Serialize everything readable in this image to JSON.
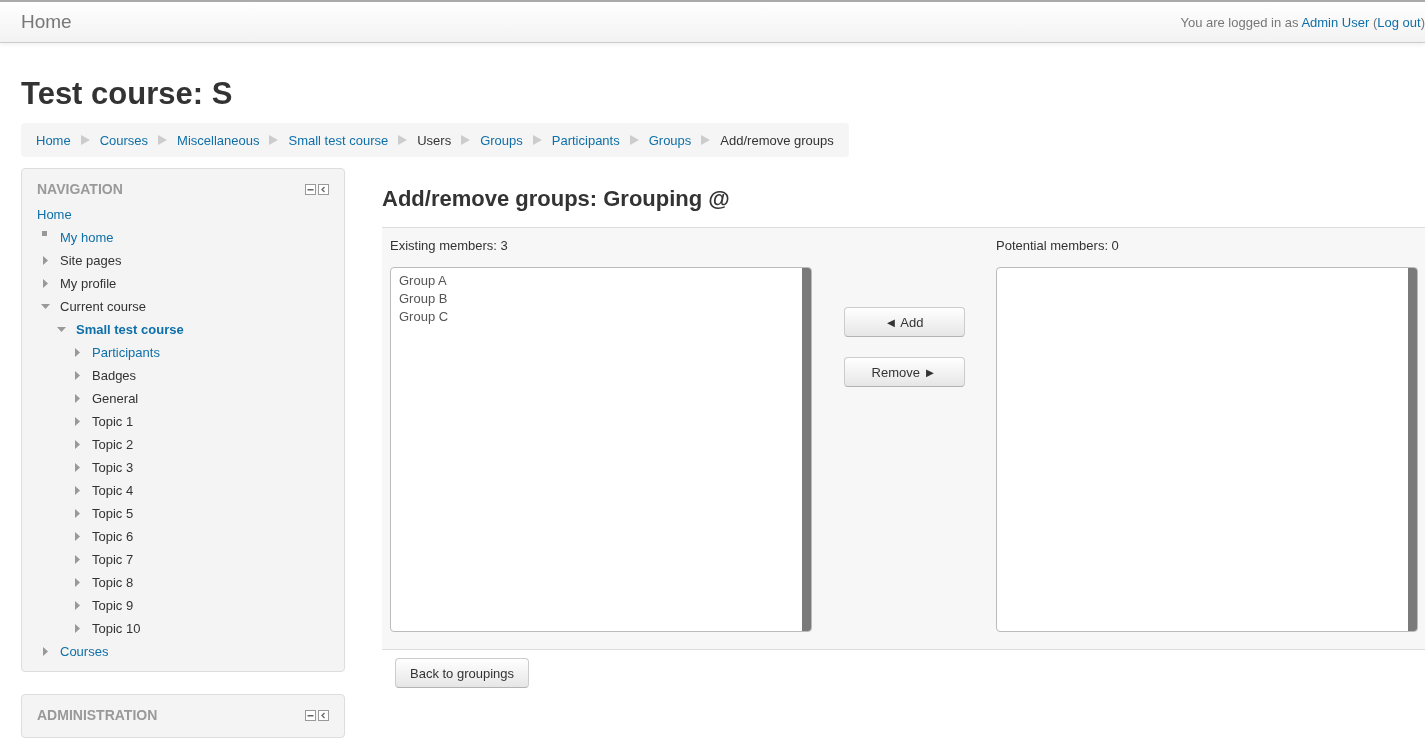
{
  "header": {
    "brand": "Home",
    "login": {
      "prefix": "You are logged in as",
      "user": "Admin User",
      "open": "(",
      "logout": "Log out",
      "close": ")"
    }
  },
  "page_title": "Test course: S",
  "breadcrumb": [
    {
      "label": "Home",
      "link": true
    },
    {
      "label": "Courses",
      "link": true
    },
    {
      "label": "Miscellaneous",
      "link": true
    },
    {
      "label": "Small test course",
      "link": true
    },
    {
      "label": "Users",
      "link": false
    },
    {
      "label": "Groups",
      "link": true
    },
    {
      "label": "Participants",
      "link": true
    },
    {
      "label": "Groups",
      "link": true
    },
    {
      "label": "Add/remove groups",
      "link": false
    }
  ],
  "navigation": {
    "title": "NAVIGATION",
    "items": [
      {
        "label": "Home",
        "kind": "root",
        "link": true,
        "children": [
          {
            "label": "My home",
            "kind": "leaf",
            "link": true
          },
          {
            "label": "Site pages",
            "kind": "branch",
            "link": false,
            "expanded": false
          },
          {
            "label": "My profile",
            "kind": "branch",
            "link": false,
            "expanded": false
          },
          {
            "label": "Current course",
            "kind": "branch",
            "link": false,
            "expanded": true,
            "children": [
              {
                "label": "Small test course",
                "kind": "branch",
                "link": true,
                "bold": true,
                "expanded": true,
                "children": [
                  {
                    "label": "Participants",
                    "kind": "branch",
                    "link": true,
                    "expanded": false
                  },
                  {
                    "label": "Badges",
                    "kind": "branch",
                    "link": false,
                    "expanded": false
                  },
                  {
                    "label": "General",
                    "kind": "branch",
                    "link": false,
                    "expanded": false
                  },
                  {
                    "label": "Topic 1",
                    "kind": "branch",
                    "link": false,
                    "expanded": false
                  },
                  {
                    "label": "Topic 2",
                    "kind": "branch",
                    "link": false,
                    "expanded": false
                  },
                  {
                    "label": "Topic 3",
                    "kind": "branch",
                    "link": false,
                    "expanded": false
                  },
                  {
                    "label": "Topic 4",
                    "kind": "branch",
                    "link": false,
                    "expanded": false
                  },
                  {
                    "label": "Topic 5",
                    "kind": "branch",
                    "link": false,
                    "expanded": false
                  },
                  {
                    "label": "Topic 6",
                    "kind": "branch",
                    "link": false,
                    "expanded": false
                  },
                  {
                    "label": "Topic 7",
                    "kind": "branch",
                    "link": false,
                    "expanded": false
                  },
                  {
                    "label": "Topic 8",
                    "kind": "branch",
                    "link": false,
                    "expanded": false
                  },
                  {
                    "label": "Topic 9",
                    "kind": "branch",
                    "link": false,
                    "expanded": false
                  },
                  {
                    "label": "Topic 10",
                    "kind": "branch",
                    "link": false,
                    "expanded": false
                  }
                ]
              }
            ]
          },
          {
            "label": "Courses",
            "kind": "branch",
            "link": true,
            "expanded": false
          }
        ]
      }
    ]
  },
  "administration": {
    "title": "ADMINISTRATION"
  },
  "main": {
    "heading": "Add/remove groups: Grouping @",
    "existing": {
      "label": "Existing members: 3",
      "options": [
        "Group A",
        "Group B",
        "Group C"
      ]
    },
    "potential": {
      "label": "Potential members: 0"
    },
    "add_button": "◄ Add",
    "remove_button": "Remove ►",
    "back_button": "Back to groupings"
  }
}
